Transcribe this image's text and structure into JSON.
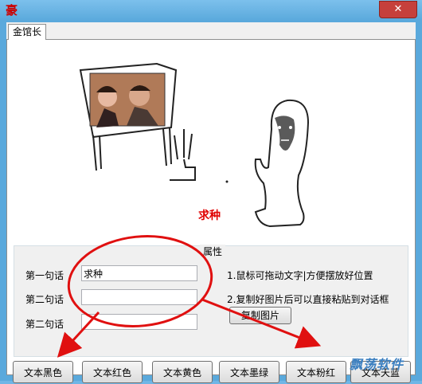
{
  "window": {
    "icon": "豪",
    "close_label": "✕"
  },
  "tabs": [
    {
      "label": "金馆长"
    }
  ],
  "meme": {
    "caption": "求种"
  },
  "properties": {
    "title": "属性",
    "fields": [
      {
        "label": "第一句话",
        "value": "求种"
      },
      {
        "label": "第二句话",
        "value": ""
      },
      {
        "label": "第二句话",
        "value": ""
      }
    ],
    "hints": [
      "1.鼠标可拖动文字|方便摆放好位置",
      "2.复制好图片后可以直接粘贴到对话框"
    ],
    "copy_button": "复制图片"
  },
  "buttons": [
    "文本黑色",
    "文本红色",
    "文本黄色",
    "文本墨绿",
    "文本粉红",
    "文本天蓝"
  ],
  "watermark": "飘荡软件",
  "colors": {
    "caption": "#e00000",
    "annotation": "#e01010",
    "titlebar": "#5aa9dc"
  }
}
